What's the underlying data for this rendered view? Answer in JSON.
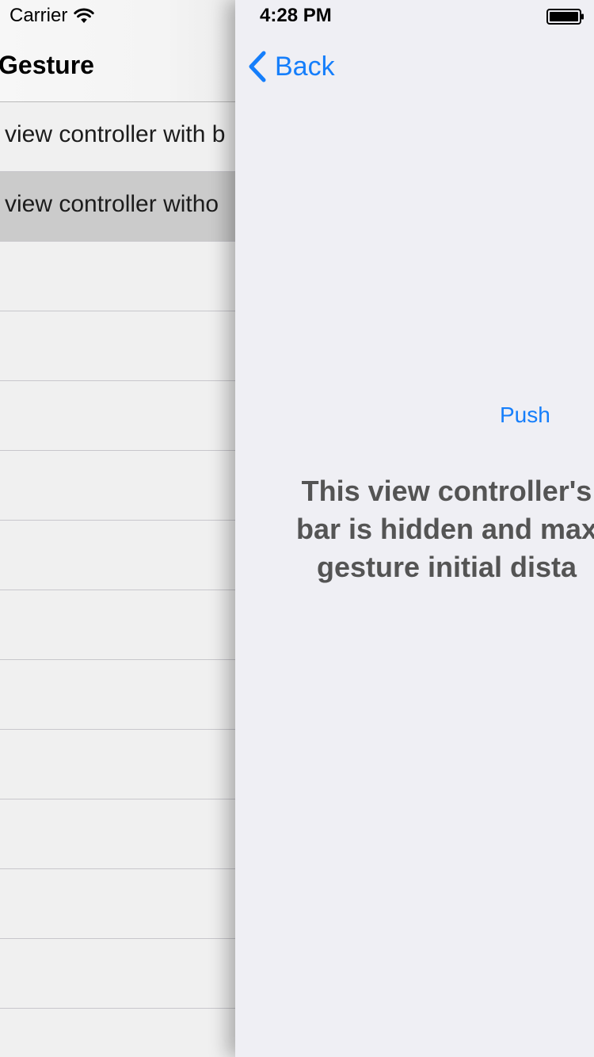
{
  "status_bar": {
    "carrier": "Carrier",
    "time": "4:28 PM"
  },
  "under_view": {
    "title": "Gesture",
    "cells": [
      {
        "label": "view controller with b",
        "selected": false
      },
      {
        "label": "view controller witho",
        "selected": true
      },
      {
        "label": "",
        "selected": false
      },
      {
        "label": "",
        "selected": false
      },
      {
        "label": "",
        "selected": false
      },
      {
        "label": "",
        "selected": false
      },
      {
        "label": "",
        "selected": false
      },
      {
        "label": "",
        "selected": false
      },
      {
        "label": "",
        "selected": false
      },
      {
        "label": "",
        "selected": false
      },
      {
        "label": "",
        "selected": false
      },
      {
        "label": "",
        "selected": false
      },
      {
        "label": "",
        "selected": false
      },
      {
        "label": "",
        "selected": false
      }
    ]
  },
  "top_view": {
    "back_label": "Back",
    "push_label": "Push",
    "message_lines": [
      "This view controller's",
      "bar is hidden and max",
      "gesture initial dista"
    ]
  },
  "colors": {
    "accent": "#157efb",
    "selected_cell": "#cbcbcb",
    "background": "#efeff4",
    "message_text": "#545454"
  }
}
